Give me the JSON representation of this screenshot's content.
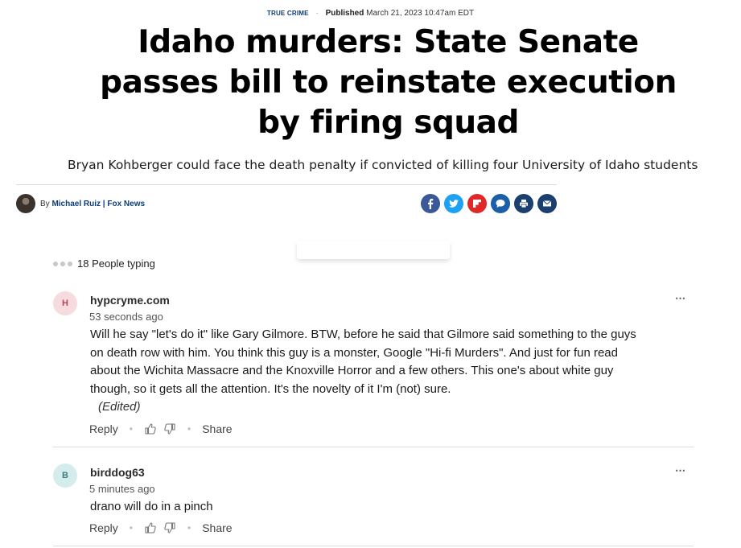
{
  "article": {
    "category": "TRUE CRIME",
    "published_label": "Published",
    "published_date": "March 21, 2023 10:47am EDT",
    "headline": "Idaho murders: State Senate passes bill to reinstate execution by firing squad",
    "subheadline": "Bryan Kohberger could face the death penalty if convicted of killing four University of Idaho students",
    "byline_prefix": "By",
    "author": "Michael Ruiz | Fox News"
  },
  "share": {
    "icons": [
      "facebook-icon",
      "twitter-icon",
      "flipboard-icon",
      "comments-icon",
      "print-icon",
      "email-icon"
    ],
    "colors": {
      "facebook": "#3b5998",
      "twitter": "#1da1f2",
      "flipboard": "#e12828",
      "comments": "#1b5fa8",
      "print": "#1b3f6e",
      "email": "#1b3f6e"
    }
  },
  "typing": {
    "text": "18 People typing"
  },
  "comments": [
    {
      "initial": "H",
      "username": "hypcryme.com",
      "time": "53 seconds ago",
      "body": "Will he say \"let's do it\" like Gary Gilmore. BTW, before he said that Gilmore said something to the guys on death row with him. You think this guy is a monster, Google \"Hi-fi Murders\". And just for fun read about the Wichita Massacre and the Knoxville Horror and a few others. This one's about white guy though, so it gets all the attention. It's the novelty of it I'm (not) sure.",
      "edited": "(Edited)",
      "reply_label": "Reply",
      "share_label": "Share",
      "more": "⋯",
      "avatar_bg": "#f6dcdf",
      "avatar_fg": "#b24a57"
    },
    {
      "initial": "B",
      "username": "birddog63",
      "time": "5 minutes ago",
      "body": "drano will do in a pinch",
      "reply_label": "Reply",
      "share_label": "Share",
      "more": "⋯",
      "avatar_bg": "#d5ecec",
      "avatar_fg": "#3e7d80"
    }
  ]
}
